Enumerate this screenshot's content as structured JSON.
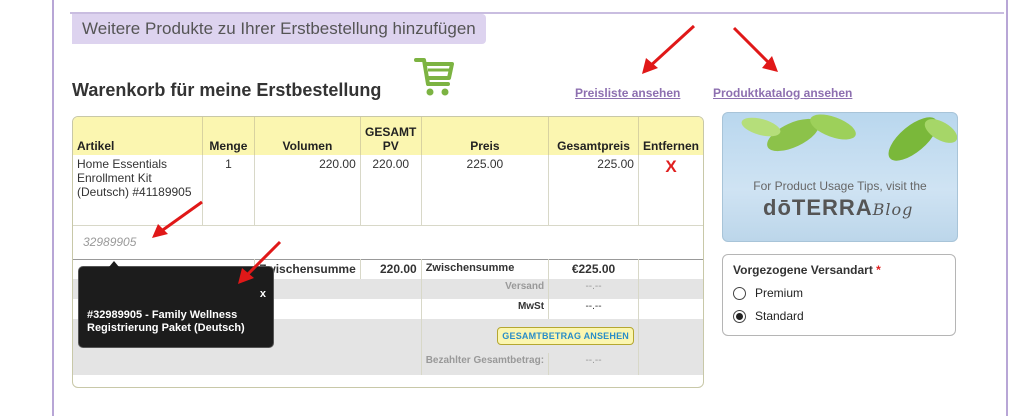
{
  "banner": "Weitere Produkte zu Ihrer Erstbestellung hinzufügen",
  "cart_title": "Warenkorb für meine Erstbestellung",
  "links": {
    "price_list": "Preisliste ansehen",
    "catalog": "Produktkatalog ansehen"
  },
  "table": {
    "headers": [
      "Artikel",
      "Menge",
      "Volumen",
      "GESAMT PV",
      "Preis",
      "Gesamtpreis",
      "Entfernen"
    ],
    "row": {
      "article": "Home Essentials Enrollment Kit (Deutsch) #41189905",
      "qty": "1",
      "volume": "220.00",
      "pv": "220.00",
      "price": "225.00",
      "total": "225.00",
      "remove": "X"
    },
    "item_code_input": "32989905",
    "subtotal_label": "Zwischensumme",
    "subtotal_pv": "220.00",
    "subtotal_label2": "Zwischensumme",
    "subtotal_value": "€225.00",
    "shipping_label": "Versand",
    "shipping_value": "--.--",
    "tax_label": "MwSt",
    "tax_value": "--.--",
    "total_button": "GESAMTBETRAG ANSEHEN",
    "paid_label": "Bezahlter Gesamtbetrag:",
    "paid_value": "--.--"
  },
  "tooltip": {
    "close": "x",
    "text": "#32989905 - Family Wellness Registrierung Paket (Deutsch)"
  },
  "blog": {
    "line1": "For Product Usage Tips, visit the",
    "brand": "dōTERRA",
    "suffix": "Blog"
  },
  "shipping": {
    "title": "Vorgezogene Versandart",
    "required": "*",
    "options": [
      "Premium",
      "Standard"
    ],
    "selected": "Standard"
  },
  "colors": {
    "banner": "#ddd3ef",
    "header": "#fbf6b0",
    "link": "#8d6fb0",
    "remove": "#e02020",
    "arrow": "#e01818"
  }
}
